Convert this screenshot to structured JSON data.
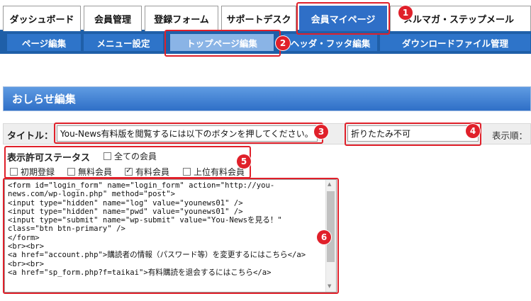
{
  "tabs": [
    "ダッシュボード",
    "会員管理",
    "登録フォーム",
    "サポートデスク",
    "会員マイページ",
    "メルマガ・ステップメール"
  ],
  "subtabs": [
    "ページ編集",
    "メニュー設定",
    "トップページ編集",
    "ヘッダ・フッタ編集",
    "ダウンロードファイル管理"
  ],
  "section_title": "おしらせ編集",
  "title_label": "タイトル：",
  "title_value": "You-News有料版を閲覧するには以下のボタンを押してください。",
  "fold_value": "折りたたみ不可",
  "display_order_label": "表示順：",
  "status": {
    "label": "表示許可ステータス",
    "all": "全ての会員",
    "options": [
      {
        "label": "初期登録",
        "checked": false
      },
      {
        "label": "無料会員",
        "checked": false
      },
      {
        "label": "有料会員",
        "checked": true
      },
      {
        "label": "上位有料会員",
        "checked": false
      }
    ]
  },
  "code_text": "<form id=\"login_form\" name=\"login_form\" action=\"http://you-news.com/wp-login.php\" method=\"post\">\n<input type=\"hidden\" name=\"log\" value=\"younews01\" />\n<input type=\"hidden\" name=\"pwd\" value=\"younews01\" />\n<input type=\"submit\" name=\"wp-submit\" value=\"You-Newsを見る！\" class=\"btn btn-primary\" />\n</form>\n<br><br>\n<a href=\"account.php\">購読者の情報（パスワード等）を変更するにはこちら</a>\n<br><br>\n<a href=\"sp_form.php?f=taikai\">有料購読を退会するにはこちら</a>",
  "badges": [
    "1",
    "2",
    "3",
    "4",
    "5",
    "6"
  ],
  "colors": {
    "accent": "#2f6fc7",
    "annotation": "#e0202a"
  }
}
